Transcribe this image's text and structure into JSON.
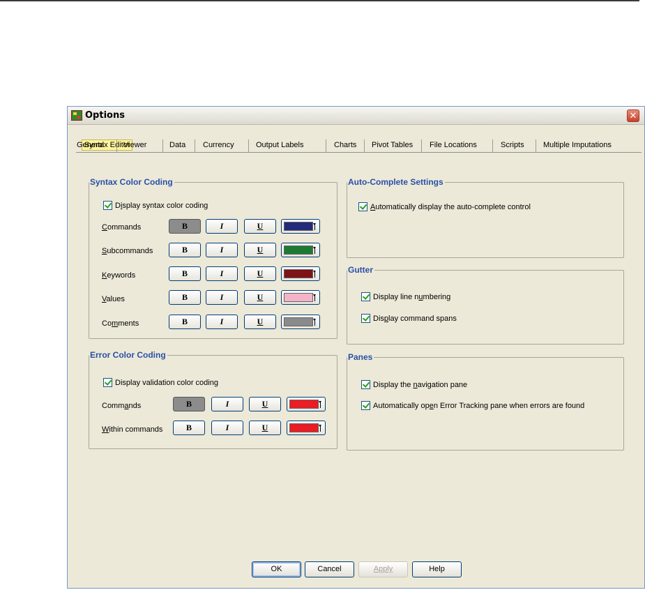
{
  "window": {
    "title": "Options",
    "close_glyph": "✕"
  },
  "tabs": {
    "active": "Syntax Editor",
    "items": [
      "General",
      "Viewer",
      "Data",
      "Currency",
      "Output Labels",
      "Charts",
      "Pivot Tables",
      "File Locations",
      "Scripts",
      "Multiple Imputations"
    ]
  },
  "syntax_color_coding": {
    "title": "Syntax Color Coding",
    "display_checkbox": {
      "label_pre": "D",
      "label_u": "i",
      "label_post": "splay syntax color coding",
      "checked": true
    },
    "rows": [
      {
        "label_u": "C",
        "label_post": "ommands",
        "bold_pressed": true,
        "color": "#232a7a"
      },
      {
        "label_u": "S",
        "label_post": "ubcommands",
        "bold_pressed": false,
        "color": "#1e7a32"
      },
      {
        "label_u": "K",
        "label_post": "eywords",
        "bold_pressed": false,
        "color": "#7e1318"
      },
      {
        "label_u": "V",
        "label_post": "alues",
        "bold_pressed": false,
        "color": "#f3b3c8"
      },
      {
        "label_pre": "Co",
        "label_u": "m",
        "label_post": "ments",
        "bold_pressed": false,
        "color": "#8a8a8a"
      }
    ],
    "bold_label": "B",
    "italic_label": "I",
    "underline_label": "U"
  },
  "error_color_coding": {
    "title": "Error Color Coding",
    "display_checkbox": {
      "label": "Display validation color coding",
      "checked": true
    },
    "rows": [
      {
        "label_pre": "Comm",
        "label_u": "a",
        "label_post": "nds",
        "bold_pressed": true,
        "color": "#ea1c24"
      },
      {
        "label_u": "W",
        "label_post": "ithin commands",
        "bold_pressed": false,
        "color": "#ea1c24"
      }
    ]
  },
  "auto_complete": {
    "title": "Auto-Complete Settings",
    "checkbox": {
      "label_u": "A",
      "label_post": "utomatically display the auto-complete control",
      "checked": true
    }
  },
  "gutter": {
    "title": "Gutter",
    "line_numbering": {
      "label_pre": "Display line n",
      "label_u": "u",
      "label_post": "mbering",
      "checked": true
    },
    "command_spans": {
      "label_pre": "Dis",
      "label_u": "p",
      "label_post": "lay command spans",
      "checked": true
    }
  },
  "panes": {
    "title": "Panes",
    "navigation": {
      "label_pre": "Display the ",
      "label_u": "n",
      "label_post": "avigation pane",
      "checked": true
    },
    "error_tracking": {
      "label_pre": "Automatically op",
      "label_u": "e",
      "label_post": "n Error Tracking pane when errors are found",
      "checked": true
    }
  },
  "buttons": {
    "ok": "OK",
    "cancel": "Cancel",
    "apply": "Apply",
    "help": "Help"
  }
}
